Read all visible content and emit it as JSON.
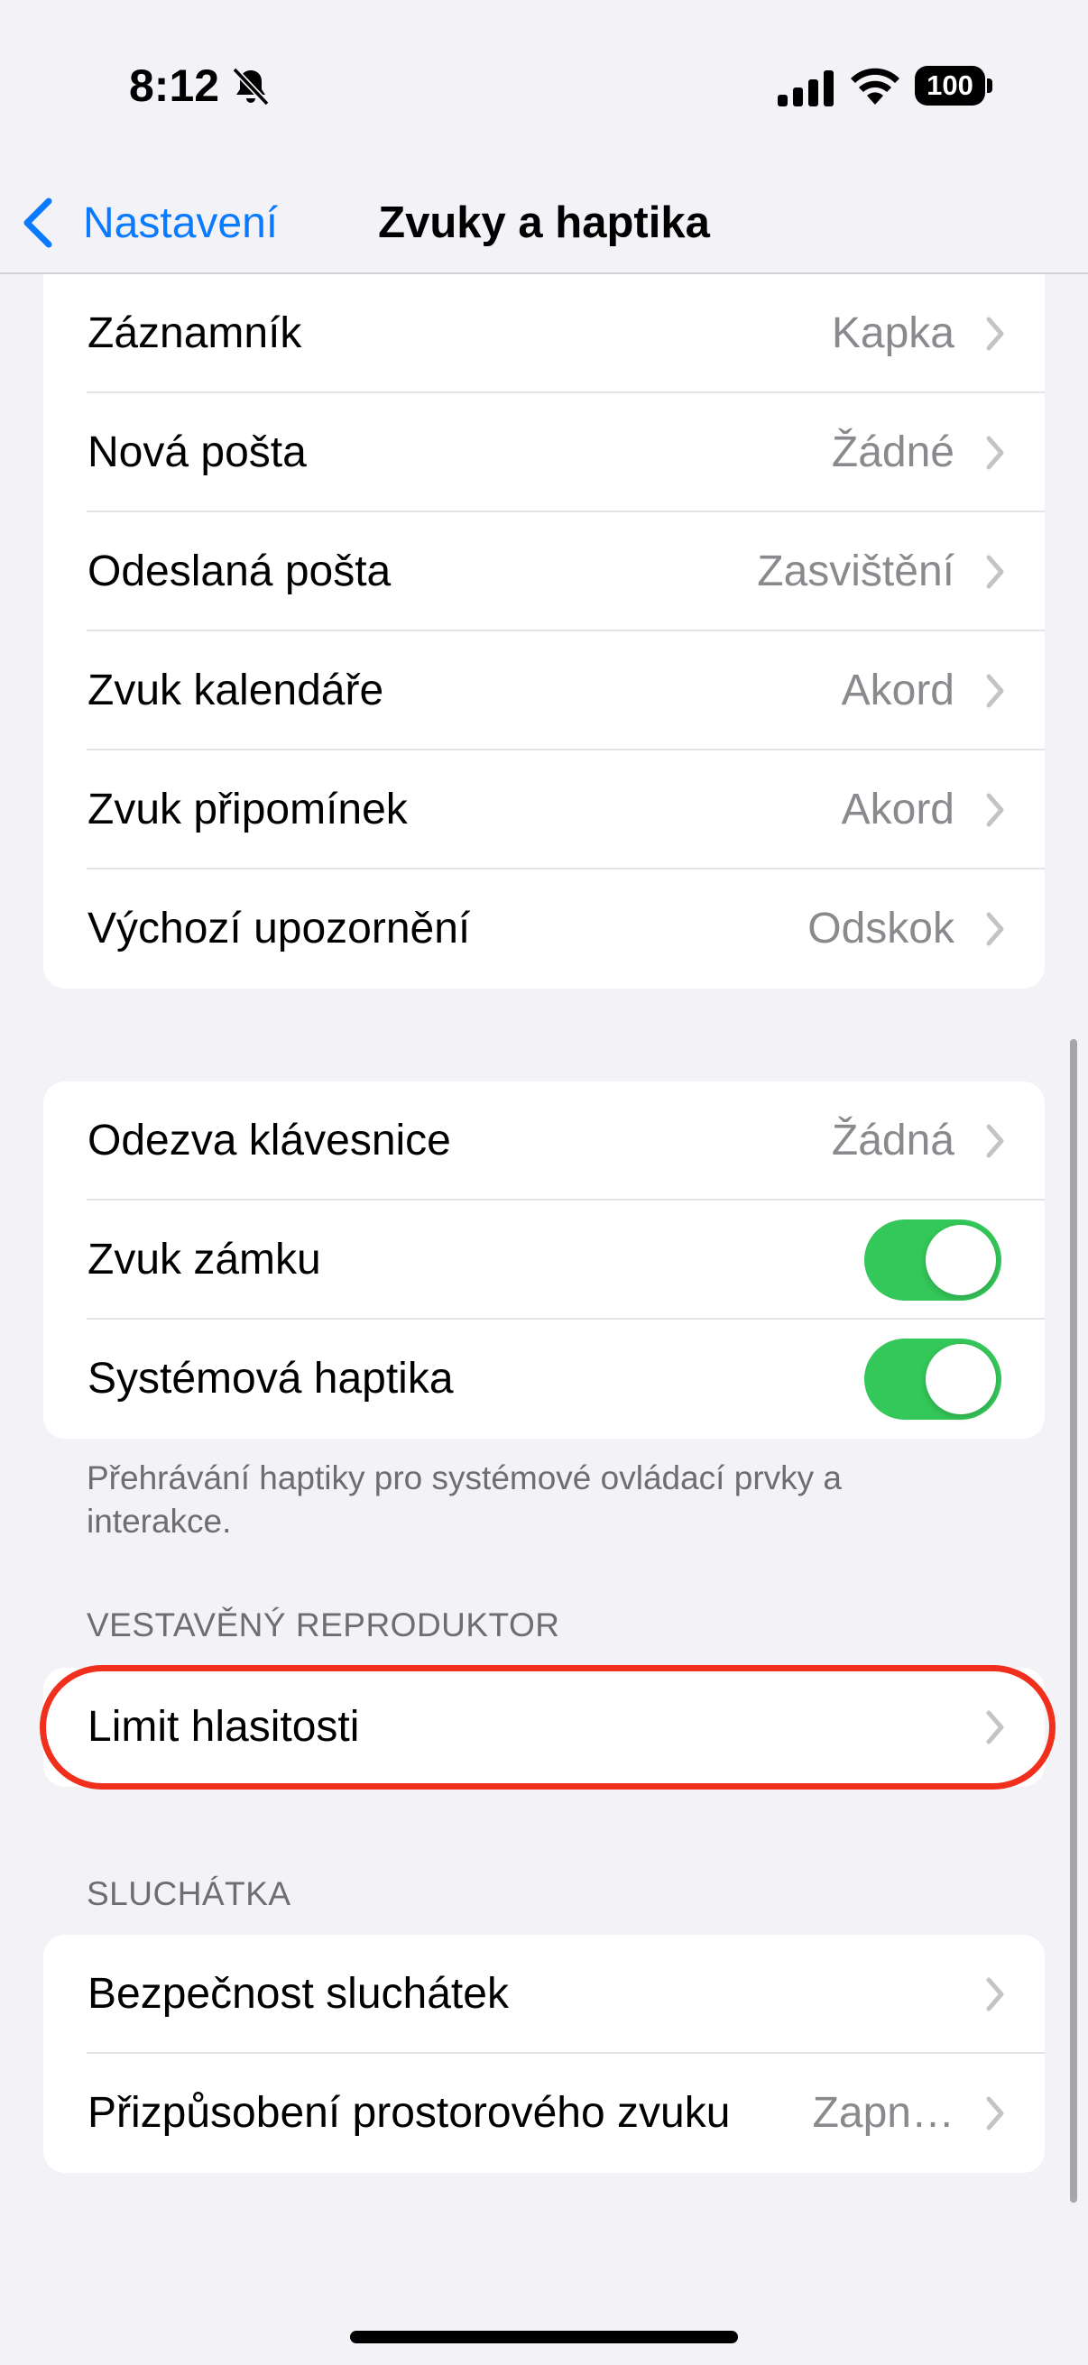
{
  "status_bar": {
    "time": "8:12",
    "battery": "100"
  },
  "nav": {
    "back_label": "Nastavení",
    "title": "Zvuky a haptika"
  },
  "group1": {
    "rows": [
      {
        "label": "Záznamník",
        "value": "Kapka"
      },
      {
        "label": "Nová pošta",
        "value": "Žádné"
      },
      {
        "label": "Odeslaná pošta",
        "value": "Zasvištění"
      },
      {
        "label": "Zvuk kalendáře",
        "value": "Akord"
      },
      {
        "label": "Zvuk připomínek",
        "value": "Akord"
      },
      {
        "label": "Výchozí upozornění",
        "value": "Odskok"
      }
    ]
  },
  "group2": {
    "keyboard": {
      "label": "Odezva klávesnice",
      "value": "Žádná"
    },
    "lock_sound": {
      "label": "Zvuk zámku",
      "on": true
    },
    "system_haptics": {
      "label": "Systémová haptika",
      "on": true
    },
    "footnote": "Přehrávání haptiky pro systémové ovládací prvky a interakce."
  },
  "speaker": {
    "header": "VESTAVĚNÝ REPRODUKTOR",
    "volume_limit": {
      "label": "Limit hlasitosti"
    }
  },
  "headphones": {
    "header": "SLUCHÁTKA",
    "safety": {
      "label": "Bezpečnost sluchátek"
    },
    "spatial": {
      "label": "Přizpůsobení prostorového zvuku",
      "value": "Zapn…"
    }
  },
  "colors": {
    "accent": "#0a7aff",
    "toggle_on": "#34c759",
    "highlight": "#f0301c",
    "background": "#f2f2f7"
  }
}
